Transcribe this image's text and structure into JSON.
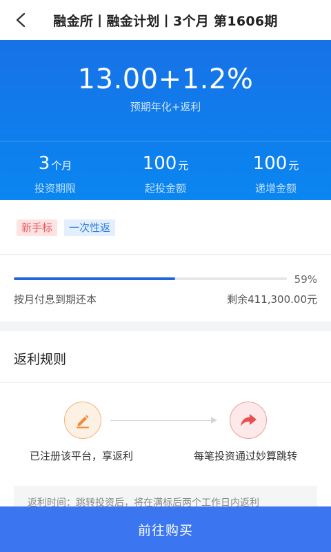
{
  "header": {
    "title": "融金所丨融金计划丨3个月 第1606期",
    "back_icon": "chevron-left-icon"
  },
  "hero": {
    "rate": "13.00+1.2%",
    "rate_label": "预期年化+返利",
    "stats": [
      {
        "value": "3",
        "unit": "个月",
        "label": "投资期限"
      },
      {
        "value": "100",
        "unit": "元",
        "label": "起投金额"
      },
      {
        "value": "100",
        "unit": "元",
        "label": "递增金额"
      }
    ]
  },
  "tags": [
    {
      "label": "新手标",
      "color": "#ea5a5a"
    },
    {
      "label": "一次性返",
      "color": "#2f7de0"
    }
  ],
  "progress": {
    "percent_value": 59,
    "percent_text": "59%",
    "repayment": "按月付息到期还本",
    "remaining": "剩余411,300.00元"
  },
  "rules": {
    "title": "返利规则",
    "steps": [
      {
        "label": "已注册该平台，享返利",
        "icon": "pencil-icon"
      },
      {
        "label": "每笔投资通过妙算跳转",
        "icon": "share-arrow-icon"
      }
    ],
    "note": "返利时间：跳转投资后，将在满标后两个工作日内返利"
  },
  "footer": {
    "buy_label": "前往购买"
  },
  "colors": {
    "primary": "#1772e6",
    "button": "#3b76f0",
    "progress": "#2266dd"
  }
}
